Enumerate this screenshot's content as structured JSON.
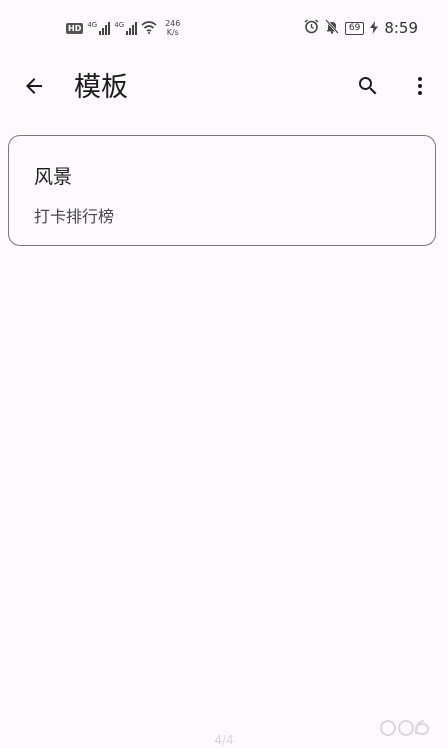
{
  "status_bar": {
    "hd_badge": "HD",
    "sim1_label": "4G",
    "sim2_label": "4G",
    "net_speed_value": "246",
    "net_speed_unit": "K/s",
    "battery": "69",
    "time": "8:59"
  },
  "header": {
    "title": "模板"
  },
  "templates": [
    {
      "title": "风景",
      "subtitle": "打卡排行榜"
    }
  ],
  "page_indicator": "4/4",
  "icons": {
    "back": "arrow-back-icon",
    "search": "search-icon",
    "more": "more-vert-icon"
  },
  "colors": {
    "background": "#fdf9fd",
    "card_border": "#7a757f",
    "text_primary": "#1c1b1f",
    "text_secondary": "#49454f"
  }
}
